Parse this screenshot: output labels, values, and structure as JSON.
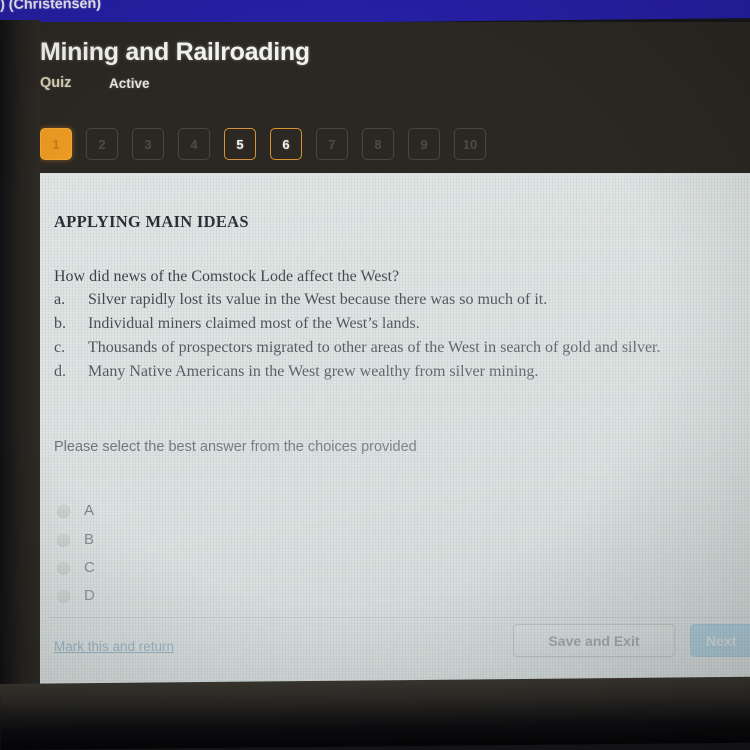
{
  "topbar": {
    "text": ") (Christensen)",
    "color": "#261fa4"
  },
  "header": {
    "title": "Mining and Railroading",
    "type_label": "Quiz",
    "status_label": "Active",
    "accent_color": "#eb9a22",
    "background": "#2b2823"
  },
  "edit_icon": {
    "name": "pencil-icon"
  },
  "question_nav": {
    "items": [
      {
        "number": "1",
        "state": "current"
      },
      {
        "number": "2",
        "state": "disabled"
      },
      {
        "number": "3",
        "state": "disabled"
      },
      {
        "number": "4",
        "state": "disabled"
      },
      {
        "number": "5",
        "state": "available"
      },
      {
        "number": "6",
        "state": "available"
      },
      {
        "number": "7",
        "state": "disabled"
      },
      {
        "number": "8",
        "state": "disabled"
      },
      {
        "number": "9",
        "state": "disabled"
      },
      {
        "number": "10",
        "state": "disabled"
      }
    ]
  },
  "content": {
    "section_heading": "APPLYING MAIN IDEAS",
    "question": "How did news of the Comstock Lode affect the West?",
    "choices": [
      {
        "letter": "a.",
        "text": "Silver rapidly lost its value in the West because there was so much of it."
      },
      {
        "letter": "b.",
        "text": "Individual miners claimed most of the West’s lands."
      },
      {
        "letter": "c.",
        "text": "Thousands of prospectors migrated to other areas of the West in search of gold and silver."
      },
      {
        "letter": "d.",
        "text": "Many Native Americans in the West grew wealthy from silver mining."
      }
    ],
    "prompt": "Please select the best answer from the choices provided",
    "options": [
      {
        "label": "A",
        "selected": false
      },
      {
        "label": "B",
        "selected": false
      },
      {
        "label": "C",
        "selected": false
      },
      {
        "label": "D",
        "selected": false
      }
    ]
  },
  "footer": {
    "mark_link": "Mark this and return",
    "save_button": "Save and Exit",
    "next_button": "Next",
    "link_color": "#2f6d94",
    "next_color": "#3d9fd4"
  }
}
